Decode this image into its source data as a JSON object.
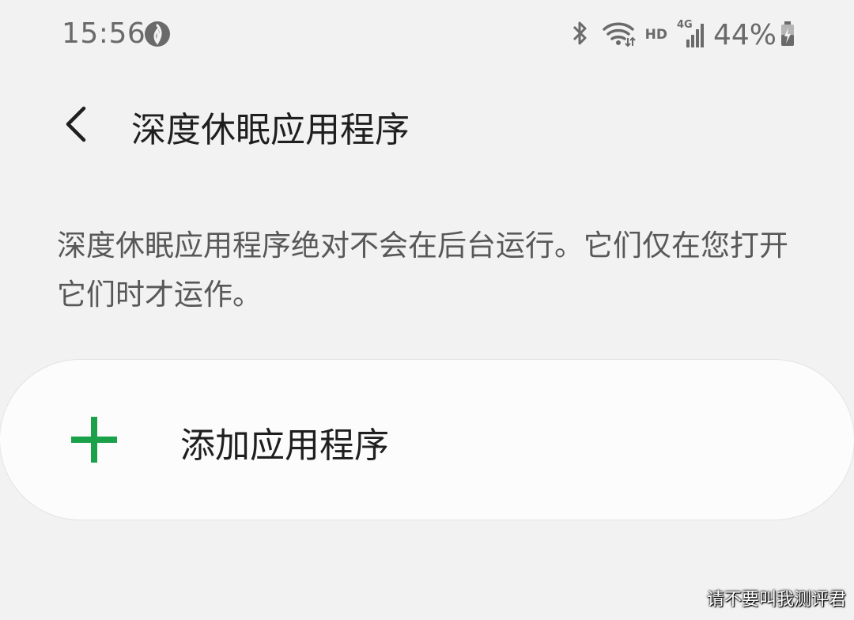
{
  "status_bar": {
    "time": "15:56",
    "network_label": "HD",
    "network_type": "4G",
    "battery_percent": "44%",
    "icons": [
      "app-notification-icon",
      "bluetooth-icon",
      "wifi-icon",
      "hd-icon",
      "signal-icon",
      "battery-charging-icon"
    ]
  },
  "header": {
    "back_icon": "chevron-left-icon",
    "title": "深度休眠应用程序"
  },
  "description": "深度休眠应用程序绝对不会在后台运行。它们仅在您打开它们时才运作。",
  "add_card": {
    "icon": "plus-icon",
    "icon_color": "#1aa14a",
    "label": "添加应用程序"
  },
  "watermark": "请不要叫我测评君"
}
